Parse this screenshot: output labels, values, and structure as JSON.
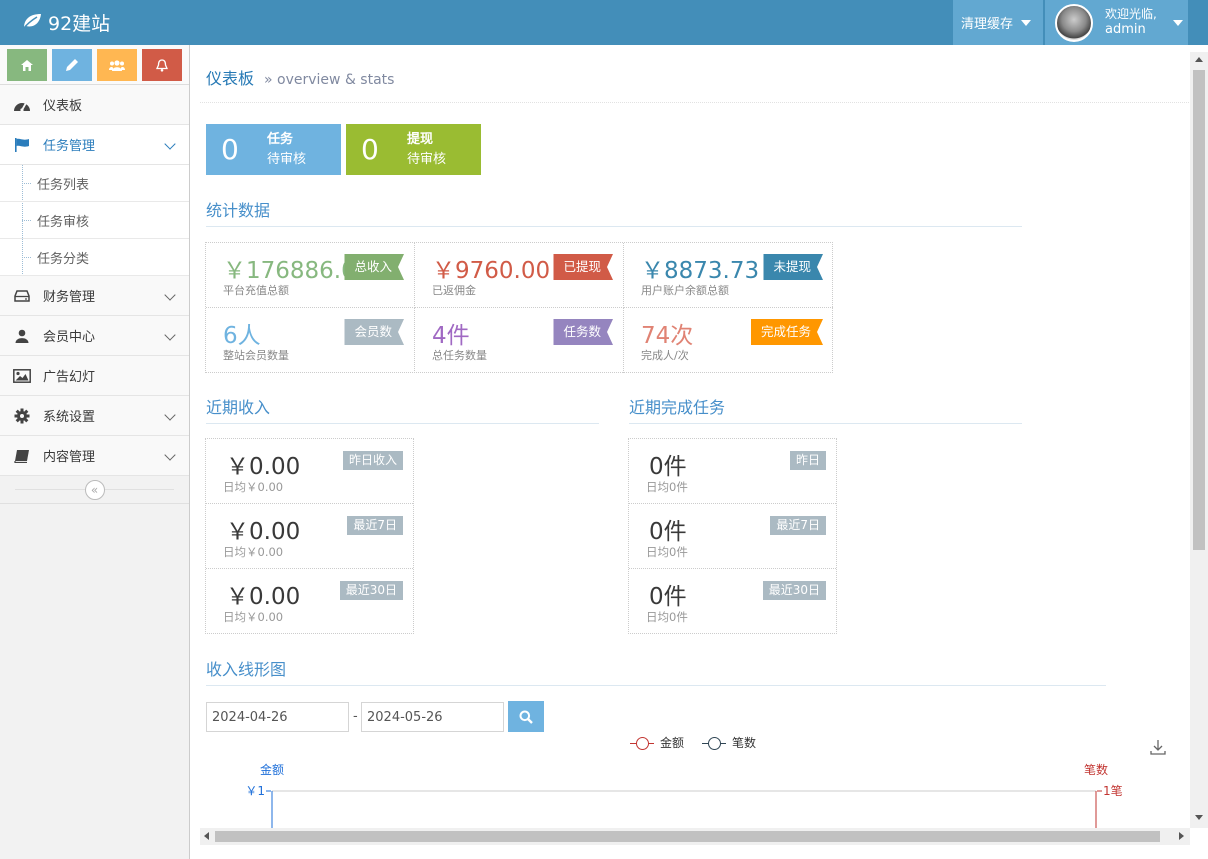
{
  "navbar": {
    "brand": "92建站",
    "clear_cache": "清理缓存",
    "welcome": "欢迎光临,",
    "username": "admin"
  },
  "shortcuts": [
    {
      "icon": "home-icon",
      "color": "#87b87f"
    },
    {
      "icon": "pencil-icon",
      "color": "#6fb3e0"
    },
    {
      "icon": "users-icon",
      "color": "#ffb752"
    },
    {
      "icon": "bell-icon",
      "color": "#d15b47"
    }
  ],
  "sidebar": {
    "dashboard": "仪表板",
    "task_mgmt": "任务管理",
    "task_sub": [
      "任务列表",
      "任务审核",
      "任务分类"
    ],
    "finance": "财务管理",
    "members": "会员中心",
    "ads": "广告幻灯",
    "settings": "系统设置",
    "content": "内容管理",
    "collapse_icon": "double-angle-left-icon"
  },
  "header": {
    "title": "仪表板",
    "subtitle": "» overview & stats"
  },
  "infoboxes": [
    {
      "value": "0",
      "title": "任务",
      "sub": "待审核",
      "color": "#6fb3e0"
    },
    {
      "value": "0",
      "title": "提现",
      "sub": "待审核",
      "color": "#9abc32"
    }
  ],
  "stats": {
    "title": "统计数据",
    "cells": [
      {
        "value": "￥176886.0",
        "desc": "平台充值总额",
        "tag": "总收入",
        "color": "#87b87f"
      },
      {
        "value": "￥9760.00",
        "desc": "已返佣金",
        "tag": "已提现",
        "color": "#d15b47"
      },
      {
        "value": "￥8873.73",
        "desc": "用户账户余额总额",
        "tag": "未提现",
        "color": "#3a87ad"
      },
      {
        "value": "6人",
        "desc": "整站会员数量",
        "tag": "会员数",
        "color": "#6fb3e0"
      },
      {
        "value": "4件",
        "desc": "总任务数量",
        "tag": "任务数",
        "color": "#a069c3"
      },
      {
        "value": "74次",
        "desc": "完成人/次",
        "tag": "完成任务",
        "color": "#e08374"
      }
    ]
  },
  "income": {
    "title": "近期收入",
    "rows": [
      {
        "value": "￥0.00",
        "desc": "日均￥0.00",
        "badge": "昨日收入"
      },
      {
        "value": "￥0.00",
        "desc": "日均￥0.00",
        "badge": "最近7日"
      },
      {
        "value": "￥0.00",
        "desc": "日均￥0.00",
        "badge": "最近30日"
      }
    ]
  },
  "tasks": {
    "title": "近期完成任务",
    "rows": [
      {
        "value": "0件",
        "desc": "日均0件",
        "badge": "昨日"
      },
      {
        "value": "0件",
        "desc": "日均0件",
        "badge": "最近7日"
      },
      {
        "value": "0件",
        "desc": "日均0件",
        "badge": "最近30日"
      }
    ]
  },
  "chart_section": {
    "title": "收入线形图",
    "date_from": "2024-04-26",
    "date_sep": "-",
    "date_to": "2024-05-26"
  },
  "chart_data": {
    "type": "line",
    "series": [
      {
        "name": "金额",
        "color": "#c23531",
        "values": []
      },
      {
        "name": "笔数",
        "color": "#2f4554",
        "values": []
      }
    ],
    "y_left": {
      "label": "金额",
      "max_tick": "￥1",
      "color": "#1e6fd9"
    },
    "y_right": {
      "label": "笔数",
      "max_tick": "1笔",
      "color": "#c23531"
    },
    "download_icon": "download-icon"
  }
}
